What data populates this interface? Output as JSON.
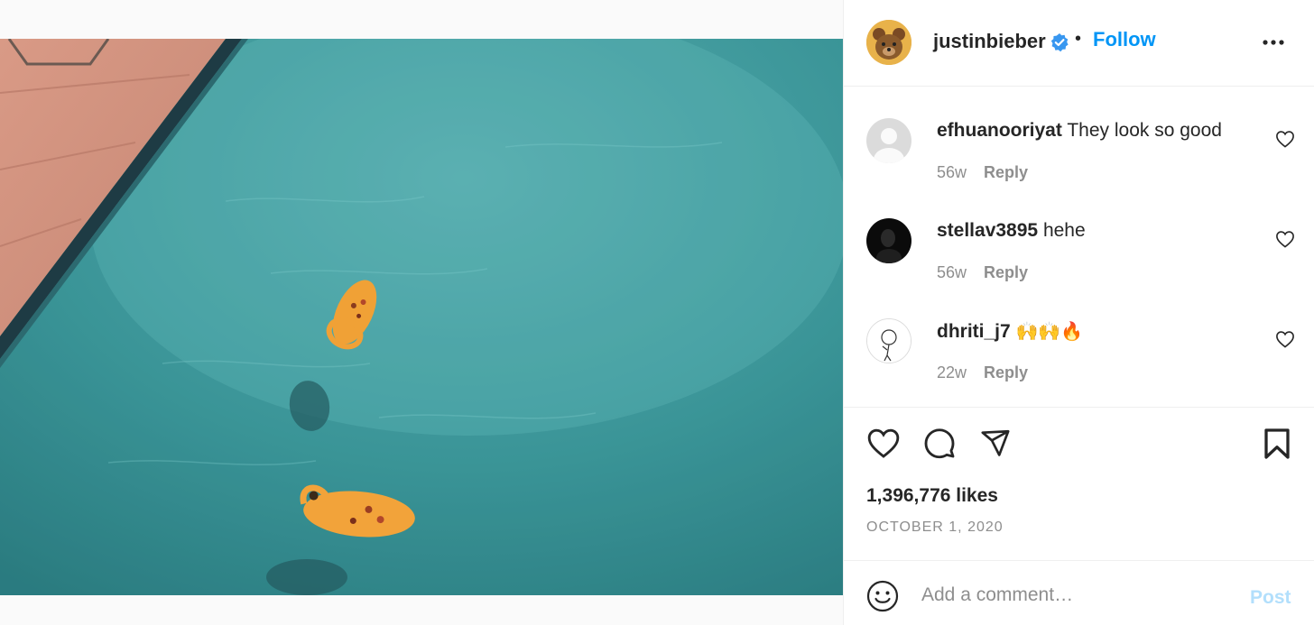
{
  "header": {
    "username": "justinbieber",
    "separator": "•",
    "follow_label": "Follow"
  },
  "comments": [
    {
      "user": "efhuanooriyat",
      "text": "They look so good",
      "time": "56w",
      "reply_label": "Reply"
    },
    {
      "user": "stellav3895",
      "text": "hehe",
      "time": "56w",
      "reply_label": "Reply"
    },
    {
      "user": "dhriti_j7",
      "text": "🙌🙌🔥",
      "time": "22w",
      "reply_label": "Reply"
    }
  ],
  "post": {
    "likes": "1,396,776 likes",
    "date": "OCTOBER 1, 2020"
  },
  "composer": {
    "placeholder": "Add a comment…",
    "post_label": "Post"
  },
  "colors": {
    "accent": "#0095f6",
    "post_disabled": "#b2dffc",
    "secondary_text": "#8e8e8e",
    "pool_water": "#3f9fa0",
    "crocs_orange": "#f2a33a"
  },
  "icons": [
    "verified-badge-icon",
    "more-options-icon",
    "heart-icon",
    "comment-icon",
    "share-icon",
    "bookmark-icon",
    "emoji-icon"
  ]
}
